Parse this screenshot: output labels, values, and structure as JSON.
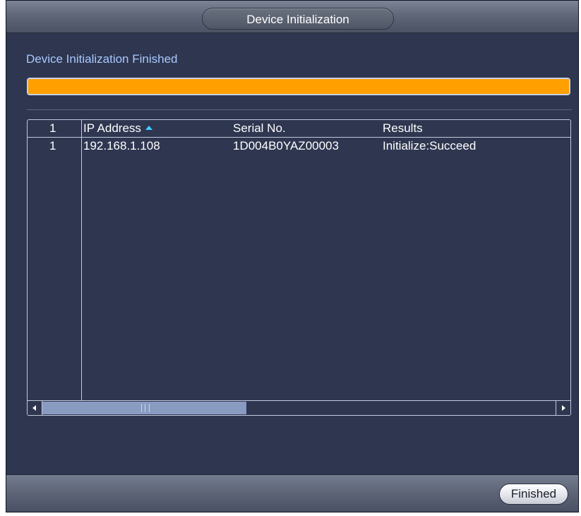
{
  "window": {
    "title": "Device Initialization"
  },
  "status": {
    "message": "Device Initialization Finished",
    "progress": 1.0
  },
  "colors": {
    "progress_fill": "#ffa000",
    "status_text": "#a9c8ff",
    "sort_arrow": "#3fd0ff"
  },
  "table": {
    "headers": {
      "index": "1",
      "ip": "IP Address",
      "serial": "Serial No.",
      "results": "Results"
    },
    "sort": {
      "column": "ip",
      "direction": "ascending"
    },
    "rows": [
      {
        "index": "1",
        "ip": "192.168.1.108",
        "serial": "1D004B0YAZ00003",
        "results": "Initialize:Succeed"
      }
    ]
  },
  "footer": {
    "finished_label": "Finished"
  }
}
